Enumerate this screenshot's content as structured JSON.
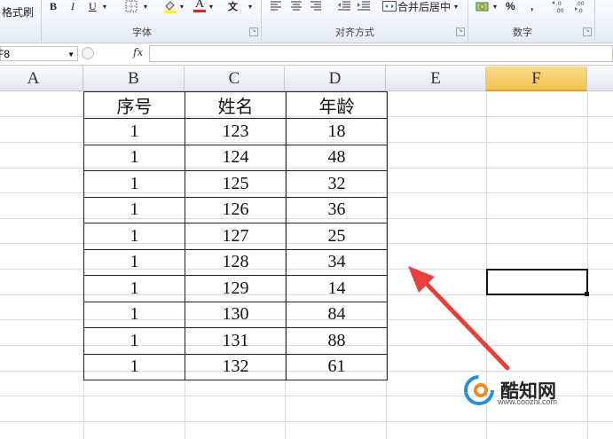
{
  "ribbon": {
    "format_painter": "格式刷",
    "bold": "B",
    "italic": "I",
    "underline": "U",
    "font_color_glyph": "A",
    "phonetic_glyph": "文",
    "merge_center": "合并后居中",
    "percent": "%",
    "comma": ",",
    "font_group": "字体",
    "align_group": "对齐方式",
    "number_group": "数字"
  },
  "formula_bar": {
    "name_box": "F8",
    "fx": "fx",
    "value": ""
  },
  "columns": [
    "A",
    "B",
    "C",
    "D",
    "E",
    "F"
  ],
  "selected_column": "F",
  "table": {
    "headers": [
      "序号",
      "姓名",
      "年龄"
    ],
    "rows": [
      [
        "1",
        "123",
        "18"
      ],
      [
        "1",
        "124",
        "48"
      ],
      [
        "1",
        "125",
        "32"
      ],
      [
        "1",
        "126",
        "36"
      ],
      [
        "1",
        "127",
        "25"
      ],
      [
        "1",
        "128",
        "34"
      ],
      [
        "1",
        "129",
        "14"
      ],
      [
        "1",
        "130",
        "84"
      ],
      [
        "1",
        "131",
        "88"
      ],
      [
        "1",
        "132",
        "61"
      ]
    ]
  },
  "watermark": {
    "name": "酷知网",
    "url": "www.coozhi.com"
  },
  "colors": {
    "arrow": "#e8403a",
    "selected_header": "#f3c34f",
    "gridline": "#dcdcdc"
  }
}
